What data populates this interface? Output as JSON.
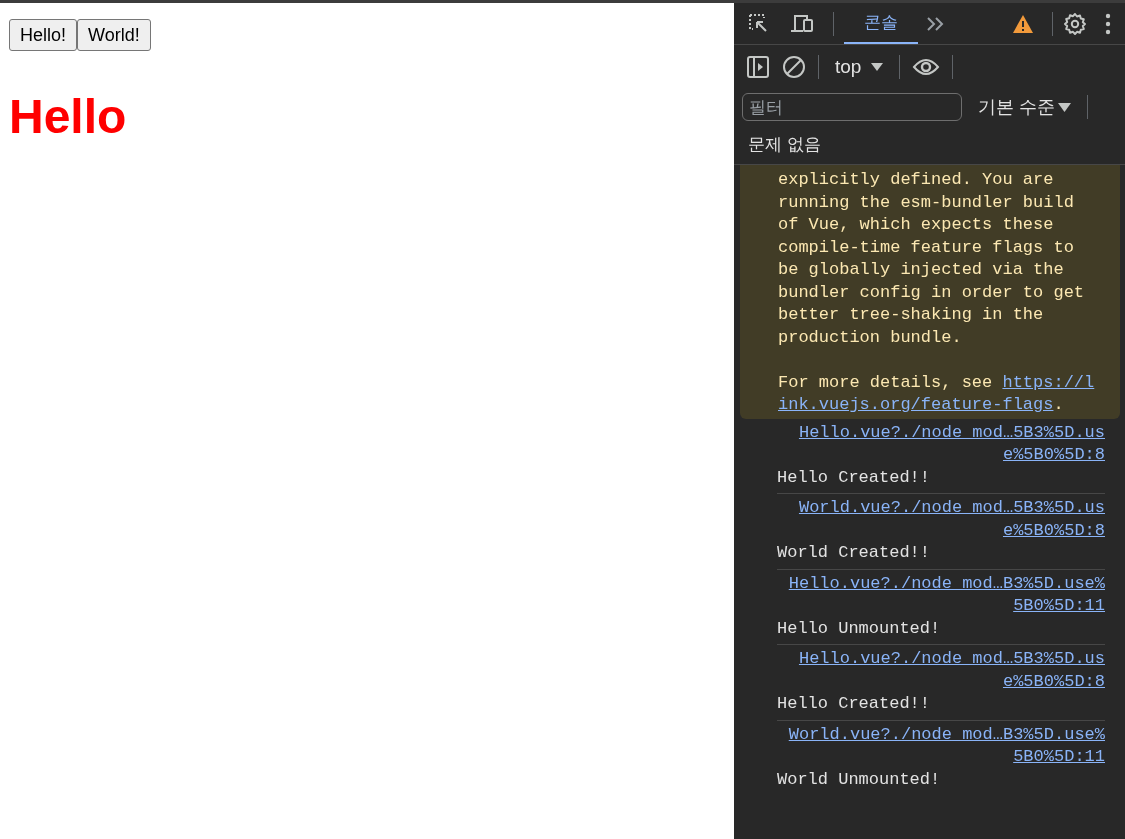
{
  "page": {
    "buttons": [
      "Hello!",
      "World!"
    ],
    "heading": "Hello"
  },
  "devtools": {
    "tabs": [
      {
        "label": "콘솔",
        "selected": true
      }
    ],
    "console_toolbar": {
      "context": "top",
      "filter": {
        "placeholder": "필터"
      },
      "levels": "기본 수준"
    },
    "issues": "문제 없음",
    "warning": {
      "text": "explicitly defined. You are running the esm-bundler build of Vue, which expects these compile-time feature flags to be globally injected via the bundler config in order to get better tree-shaking in the production bundle.",
      "details_prefix": "For more details, see ",
      "link_lines": [
        "https://l",
        "ink.vuejs.org/feature-flags"
      ],
      "details_suffix": "."
    },
    "messages": [
      {
        "source": "Hello.vue?./node_mod…5B3%5D.use%5B0%5D:8",
        "text": "Hello Created!!"
      },
      {
        "source": "World.vue?./node_mod…5B3%5D.use%5B0%5D:8",
        "text": "World Created!!"
      },
      {
        "source": "Hello.vue?./node_mod…B3%5D.use%5B0%5D:11",
        "text": "Hello Unmounted!"
      },
      {
        "source": "Hello.vue?./node_mod…5B3%5D.use%5B0%5D:8",
        "text": "Hello Created!!"
      },
      {
        "source": "World.vue?./node_mod…B3%5D.use%5B0%5D:11",
        "text": "World Unmounted!"
      }
    ]
  }
}
